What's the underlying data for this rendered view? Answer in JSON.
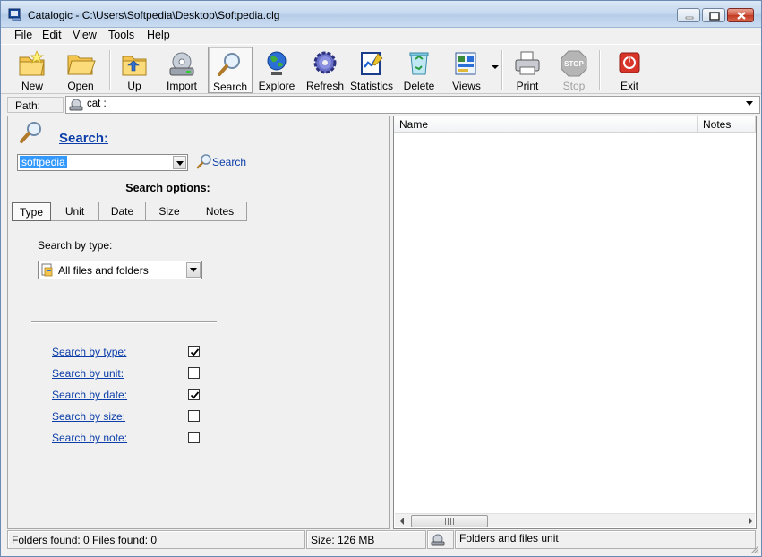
{
  "window": {
    "title": "Catalogic - C:\\Users\\Softpedia\\Desktop\\Softpedia.clg",
    "controls": [
      "minimize",
      "maximize",
      "close"
    ]
  },
  "menu": [
    "File",
    "Edit",
    "View",
    "Tools",
    "Help"
  ],
  "toolbar": {
    "new": "New",
    "open": "Open",
    "up": "Up",
    "import": "Import",
    "search": "Search",
    "explore": "Explore",
    "refresh": "Refresh",
    "statistics": "Statistics",
    "delete": "Delete",
    "views": "Views",
    "print": "Print",
    "stop": "Stop",
    "exit": "Exit"
  },
  "path": {
    "label": "Path:",
    "value": "cat :"
  },
  "search_panel": {
    "heading": "Search:",
    "query": "softpedia",
    "search_link": "Search",
    "options_heading": "Search options:",
    "tabs": [
      "Type",
      "Unit",
      "Date",
      "Size",
      "Notes"
    ],
    "active_tab": "Type",
    "by_type_label": "Search by type:",
    "type_selected": "All files and folders",
    "criteria": [
      {
        "label": "Search by type:",
        "checked": true
      },
      {
        "label": "Search by unit:",
        "checked": false
      },
      {
        "label": "Search by date:",
        "checked": true
      },
      {
        "label": "Search by size:",
        "checked": false
      },
      {
        "label": "Search by note:",
        "checked": false
      }
    ]
  },
  "results": {
    "columns": [
      "Name",
      "Notes"
    ]
  },
  "status": {
    "found": "Folders found: 0  Files found: 0",
    "size": "Size: 126 MB",
    "unit": "Folders and files unit"
  },
  "colors": {
    "link": "#0b3ea8",
    "selection": "#3399ff",
    "window_bg": "#f0f0f0"
  }
}
